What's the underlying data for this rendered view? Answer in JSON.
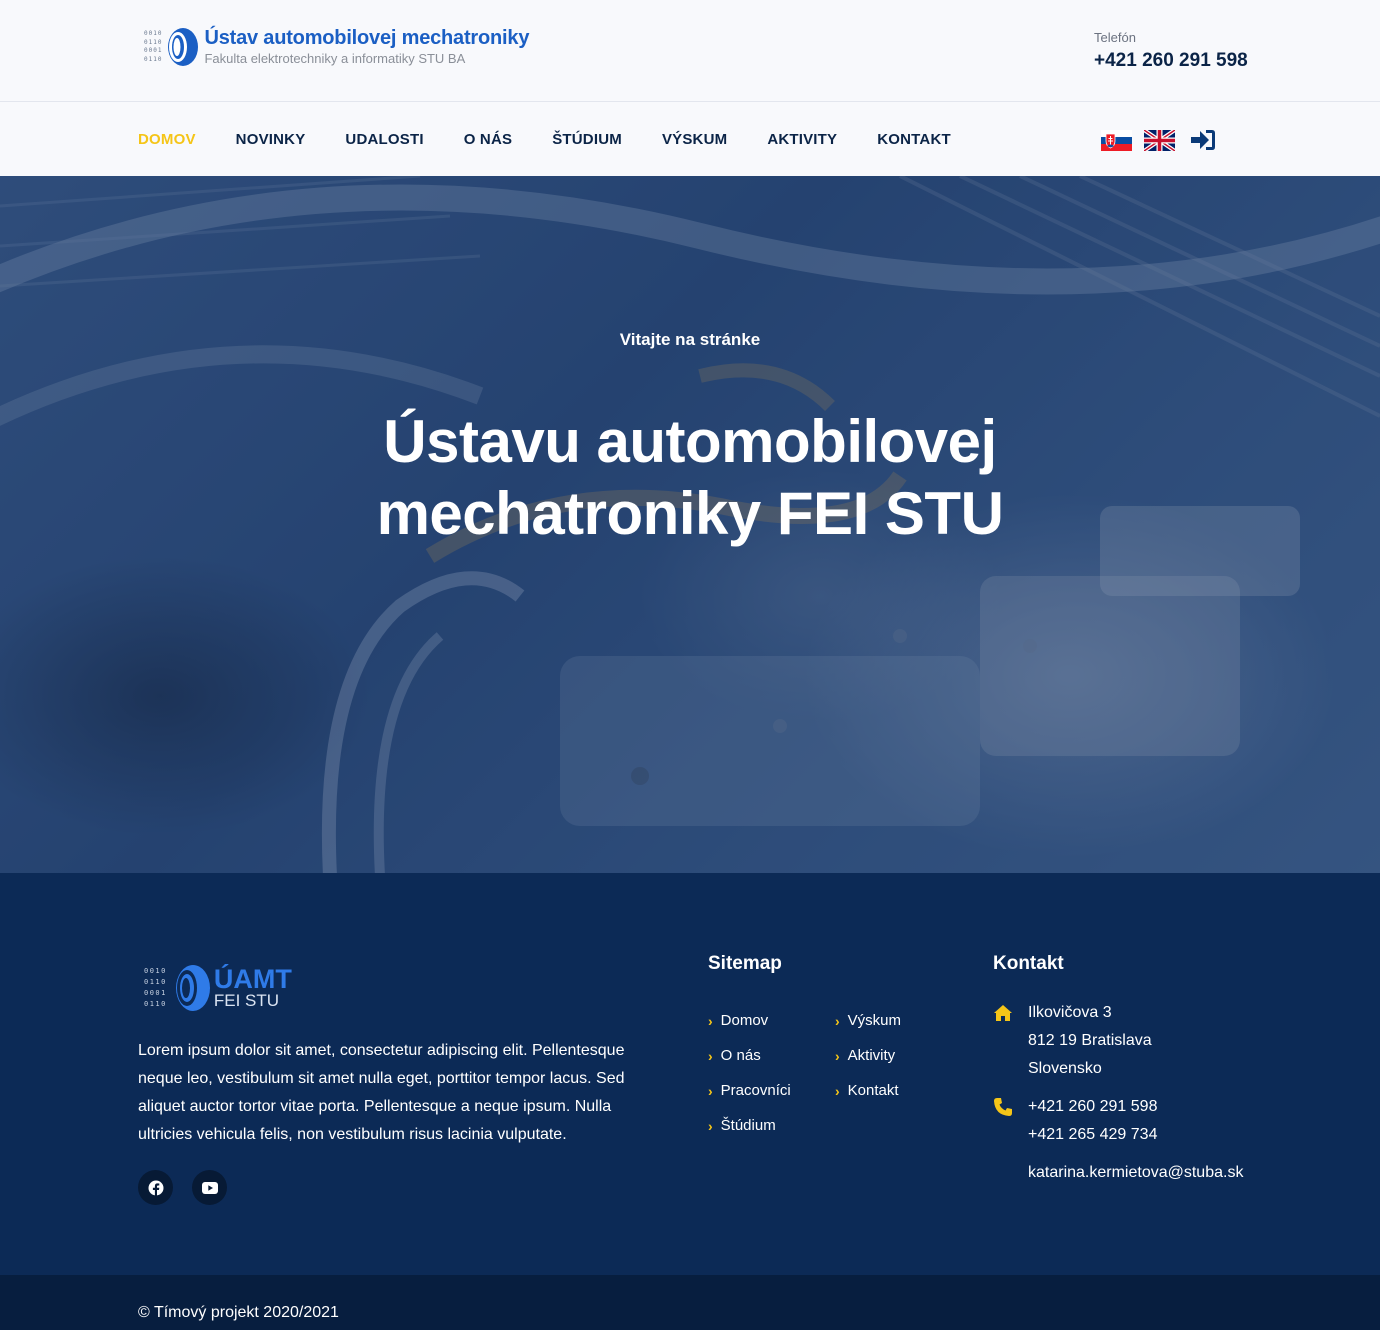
{
  "header": {
    "logo_bits": [
      "0010",
      "0110",
      "0001",
      "0110"
    ],
    "title": "Ústav automobilovej mechatroniky",
    "subtitle": "Fakulta elektrotechniky a informatiky STU BA",
    "phone_label": "Telefón",
    "phone_number": "+421 260 291 598"
  },
  "nav": {
    "items": [
      {
        "label": "DOMOV",
        "active": true
      },
      {
        "label": "NOVINKY",
        "active": false
      },
      {
        "label": "UDALOSTI",
        "active": false
      },
      {
        "label": "O NÁS",
        "active": false
      },
      {
        "label": "ŠTÚDIUM",
        "active": false
      },
      {
        "label": "VÝSKUM",
        "active": false
      },
      {
        "label": "AKTIVITY",
        "active": false
      },
      {
        "label": "KONTAKT",
        "active": false
      }
    ],
    "icons": [
      "slovak-flag-icon",
      "uk-flag-icon",
      "sign-in-icon"
    ]
  },
  "hero": {
    "kicker": "Vitajte na stránke",
    "title_line1": "Ústavu automobilovej",
    "title_line2": "mechatroniky FEI STU"
  },
  "footer": {
    "logo_bits": [
      "0010",
      "0110",
      "0001",
      "0110"
    ],
    "logo_abbr": "ÚAMT",
    "logo_sub": "FEI STU",
    "description": "Lorem ipsum dolor sit amet, consectetur adipiscing elit. Pellentesque neque leo, vestibulum sit amet nulla eget, porttitor tempor lacus. Sed aliquet auctor tortor vitae porta. Pellentesque a neque ipsum. Nulla ultricies vehicula felis, non vestibulum risus lacinia vulputate.",
    "social": [
      "facebook-icon",
      "youtube-icon"
    ],
    "sitemap_heading": "Sitemap",
    "sitemap_col1": [
      "Domov",
      "O nás",
      "Pracovníci",
      "Štúdium"
    ],
    "sitemap_col2": [
      "Výskum",
      "Aktivity",
      "Kontakt"
    ],
    "kontakt_heading": "Kontakt",
    "address": [
      "Ilkovičova 3",
      "812 19 Bratislava",
      "Slovensko"
    ],
    "phones": [
      "+421 260 291 598",
      "+421 265 429 734"
    ],
    "email": "katarina.kermietova@stuba.sk"
  },
  "bottom": {
    "copyright": "© Tímový projekt 2020/2021"
  },
  "colors": {
    "accent": "#f5c518",
    "navy": "#0b2447",
    "footer_bg": "#0c2a56",
    "bottom_bg": "#071e3f",
    "brand_blue": "#1b5fc4"
  }
}
